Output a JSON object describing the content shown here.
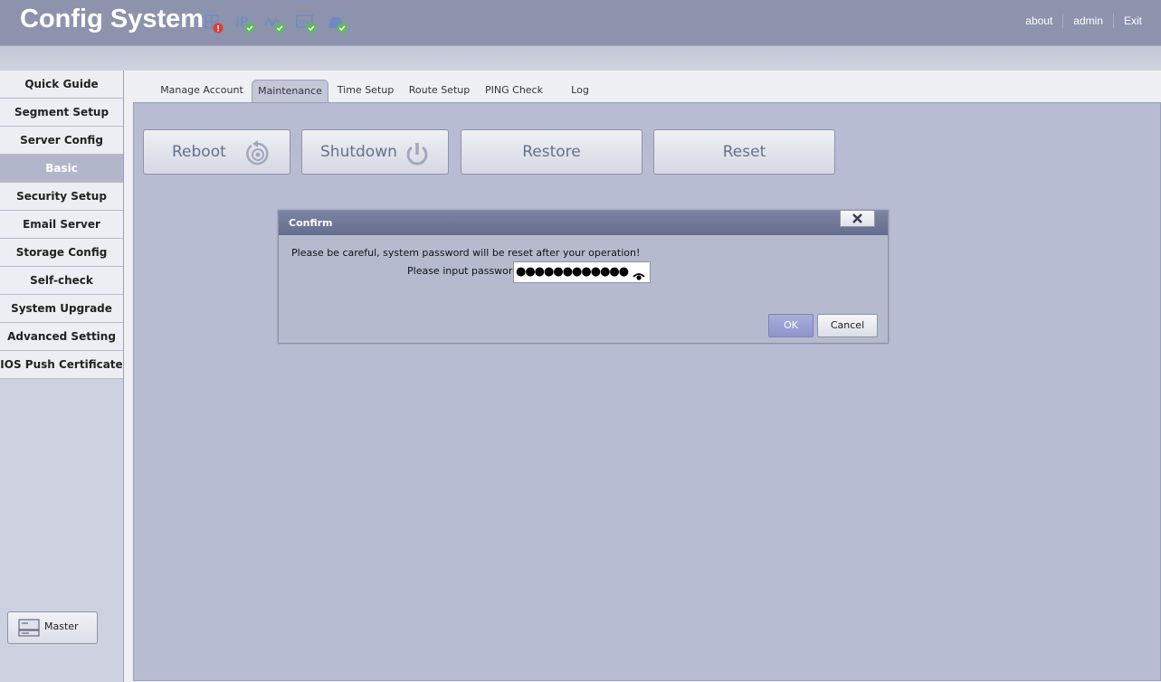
{
  "header": {
    "title": "Config System",
    "status_icons": [
      {
        "name": "network-icon",
        "status": "error",
        "label": ""
      },
      {
        "name": "ip-icon",
        "status": "ok",
        "label": "IP"
      },
      {
        "name": "wave-icon",
        "status": "ok",
        "label": ""
      },
      {
        "name": "cpu-icon",
        "status": "ok",
        "label": "CPU"
      },
      {
        "name": "storage-icon",
        "status": "ok",
        "label": ""
      }
    ],
    "links": {
      "about": "about",
      "user": "admin",
      "exit": "Exit"
    }
  },
  "sidebar": {
    "items": [
      {
        "label": "Quick Guide",
        "active": false
      },
      {
        "label": "Segment Setup",
        "active": false
      },
      {
        "label": "Server Config",
        "active": false
      },
      {
        "label": "Basic",
        "active": true
      },
      {
        "label": "Security Setup",
        "active": false
      },
      {
        "label": "Email Server",
        "active": false
      },
      {
        "label": "Storage Config",
        "active": false
      },
      {
        "label": "Self-check",
        "active": false
      },
      {
        "label": "System Upgrade",
        "active": false
      },
      {
        "label": "Advanced Setting",
        "active": false
      },
      {
        "label": "IOS Push Certificate",
        "active": false
      }
    ],
    "master_label": "Master"
  },
  "tabs": [
    {
      "label": "Manage Account",
      "active": false
    },
    {
      "label": "Maintenance",
      "active": true
    },
    {
      "label": "Time Setup",
      "active": false
    },
    {
      "label": "Route Setup",
      "active": false
    },
    {
      "label": "PING Check",
      "active": false
    },
    {
      "label": "Log",
      "active": false
    }
  ],
  "actions": {
    "reboot": "Reboot",
    "shutdown": "Shutdown",
    "restore": "Restore",
    "reset": "Reset"
  },
  "dialog": {
    "title": "Confirm",
    "message": "Please be careful, system password will be reset after your operation!",
    "password_label": "Please input password:",
    "password_value": "●●●●●●●●●●●●",
    "ok": "OK",
    "cancel": "Cancel"
  },
  "colors": {
    "header_bg": "#8d93ad",
    "content_bg": "#b8bcd2",
    "sidebar_active": "#b2b6cb",
    "status_ok": "#5dbb5d",
    "status_error": "#e53935"
  }
}
